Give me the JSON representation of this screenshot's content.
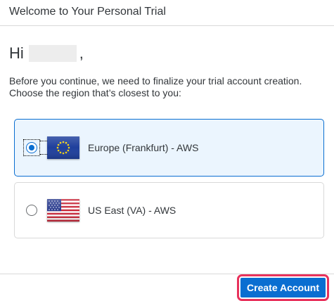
{
  "header": {
    "title": "Welcome to Your Personal Trial"
  },
  "greeting": {
    "prefix": "Hi",
    "suffix": ","
  },
  "intro": {
    "line1": "Before you continue, we need to finalize your trial account creation.",
    "line2": "Choose the region that’s closest to you:"
  },
  "regions": [
    {
      "label": "Europe (Frankfurt) - AWS",
      "flag": "eu-flag-icon",
      "selected": true
    },
    {
      "label": "US East (VA) - AWS",
      "flag": "us-flag-icon",
      "selected": false
    }
  ],
  "footer": {
    "create_label": "Create Account"
  },
  "colors": {
    "accent": "#0a6ed1",
    "selected_bg": "#ebf5fe",
    "highlight": "#e8325c"
  }
}
